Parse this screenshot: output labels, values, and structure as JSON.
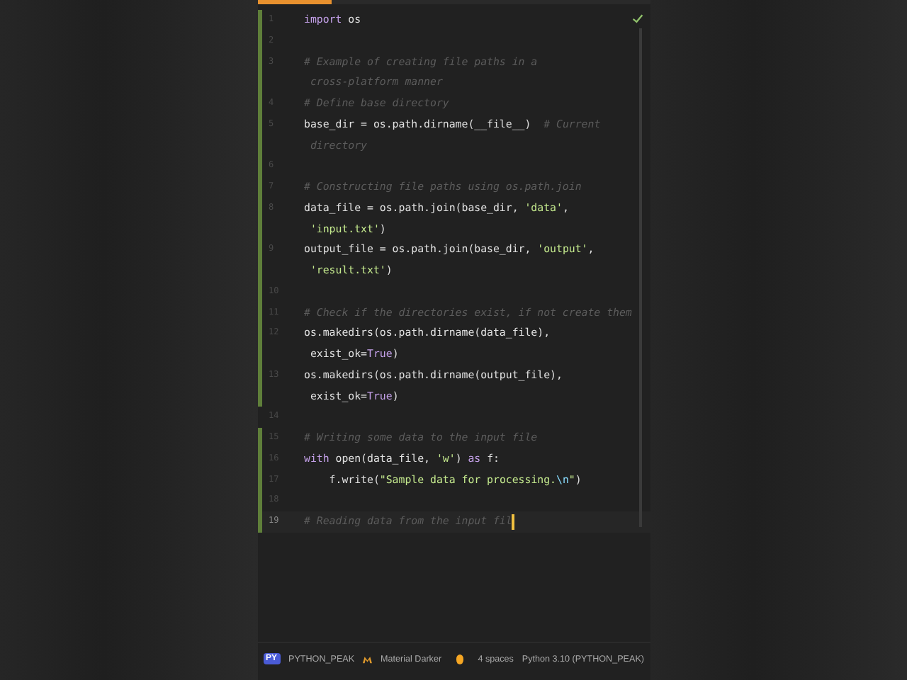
{
  "editor": {
    "progress": {
      "level": 0.19
    },
    "lines": [
      {
        "number": "1",
        "changed": true,
        "current": false,
        "rows": [
          {
            "tokens": [
              {
                "kind": "keyword",
                "text": "import"
              },
              {
                "kind": "plain",
                "text": " os"
              }
            ]
          }
        ]
      },
      {
        "number": "2",
        "changed": true,
        "current": false
      },
      {
        "number": "3",
        "changed": true,
        "current": false,
        "rows": [
          {
            "tokens": [
              {
                "kind": "comment",
                "text": "# Example of creating file paths in a"
              }
            ]
          },
          {
            "tokens": [
              {
                "kind": "comment",
                "text": " cross-platform manner"
              }
            ]
          }
        ]
      },
      {
        "number": "4",
        "changed": true,
        "current": false,
        "rows": [
          {
            "tokens": [
              {
                "kind": "comment",
                "text": "# Define base directory"
              }
            ]
          }
        ]
      },
      {
        "number": "5",
        "changed": true,
        "current": false,
        "rows": [
          {
            "tokens": [
              {
                "kind": "plain",
                "text": "base_dir = os.path.dirname(__file__)  "
              },
              {
                "kind": "comment",
                "text": "# Current"
              }
            ]
          },
          {
            "tokens": [
              {
                "kind": "comment",
                "text": " directory"
              }
            ]
          }
        ]
      },
      {
        "number": "6",
        "changed": true,
        "current": false
      },
      {
        "number": "7",
        "changed": true,
        "current": false,
        "rows": [
          {
            "tokens": [
              {
                "kind": "comment",
                "text": "# Constructing file paths using os.path.join"
              }
            ]
          }
        ]
      },
      {
        "number": "8",
        "changed": true,
        "current": false,
        "rows": [
          {
            "tokens": [
              {
                "kind": "plain",
                "text": "data_file = os.path.join(base_dir, "
              },
              {
                "kind": "string",
                "text": "'data'"
              },
              {
                "kind": "plain",
                "text": ","
              }
            ]
          },
          {
            "tokens": [
              {
                "kind": "string",
                "text": " 'input.txt'"
              },
              {
                "kind": "plain",
                "text": ")"
              }
            ]
          }
        ]
      },
      {
        "number": "9",
        "changed": true,
        "current": false,
        "rows": [
          {
            "tokens": [
              {
                "kind": "plain",
                "text": "output_file = os.path.join(base_dir, "
              },
              {
                "kind": "string",
                "text": "'output'"
              },
              {
                "kind": "plain",
                "text": ","
              }
            ]
          },
          {
            "tokens": [
              {
                "kind": "string",
                "text": " 'result.txt'"
              },
              {
                "kind": "plain",
                "text": ")"
              }
            ]
          }
        ]
      },
      {
        "number": "10",
        "changed": true,
        "current": false
      },
      {
        "number": "11",
        "changed": true,
        "current": false,
        "rows": [
          {
            "tokens": [
              {
                "kind": "comment",
                "text": "# Check if the directories exist, if not create them"
              }
            ]
          }
        ]
      },
      {
        "number": "12",
        "changed": true,
        "current": false,
        "rows": [
          {
            "tokens": [
              {
                "kind": "plain",
                "text": "os.makedirs(os.path.dirname(data_file),"
              }
            ]
          },
          {
            "tokens": [
              {
                "kind": "plain",
                "text": " exist_ok="
              },
              {
                "kind": "keyword",
                "text": "True"
              },
              {
                "kind": "plain",
                "text": ")"
              }
            ]
          }
        ]
      },
      {
        "number": "13",
        "changed": true,
        "current": false,
        "rows": [
          {
            "tokens": [
              {
                "kind": "plain",
                "text": "os.makedirs(os.path.dirname(output_file),"
              }
            ]
          },
          {
            "tokens": [
              {
                "kind": "plain",
                "text": " exist_ok="
              },
              {
                "kind": "keyword",
                "text": "True"
              },
              {
                "kind": "plain",
                "text": ")"
              }
            ]
          }
        ]
      },
      {
        "number": "14",
        "changed": false,
        "current": false
      },
      {
        "number": "15",
        "changed": true,
        "current": false,
        "rows": [
          {
            "tokens": [
              {
                "kind": "comment",
                "text": "# Writing some data to the input file"
              }
            ]
          }
        ]
      },
      {
        "number": "16",
        "changed": true,
        "current": false,
        "rows": [
          {
            "tokens": [
              {
                "kind": "keyword",
                "text": "with"
              },
              {
                "kind": "plain",
                "text": " open(data_file, "
              },
              {
                "kind": "string",
                "text": "'w'"
              },
              {
                "kind": "plain",
                "text": ") "
              },
              {
                "kind": "keyword",
                "text": "as"
              },
              {
                "kind": "plain",
                "text": " f:"
              }
            ]
          }
        ]
      },
      {
        "number": "17",
        "changed": true,
        "current": false,
        "rows": [
          {
            "tokens": [
              {
                "kind": "plain",
                "text": "    f.write("
              },
              {
                "kind": "string",
                "text": "\"Sample data for processing."
              },
              {
                "kind": "escape",
                "text": "\\n"
              },
              {
                "kind": "string",
                "text": "\""
              },
              {
                "kind": "plain",
                "text": ")"
              }
            ]
          }
        ]
      },
      {
        "number": "18",
        "changed": true,
        "current": false
      },
      {
        "number": "19",
        "changed": true,
        "current": true,
        "rows": [
          {
            "tokens": [
              {
                "kind": "comment",
                "text": "# Reading data from the input fil"
              }
            ]
          }
        ]
      }
    ]
  },
  "status_bar": {
    "project_badge": "PY",
    "project": "PYTHON_PEAK",
    "theme": "Material Darker",
    "indent": "4 spaces",
    "interpreter": "Python 3.10 (PYTHON_PEAK)"
  }
}
